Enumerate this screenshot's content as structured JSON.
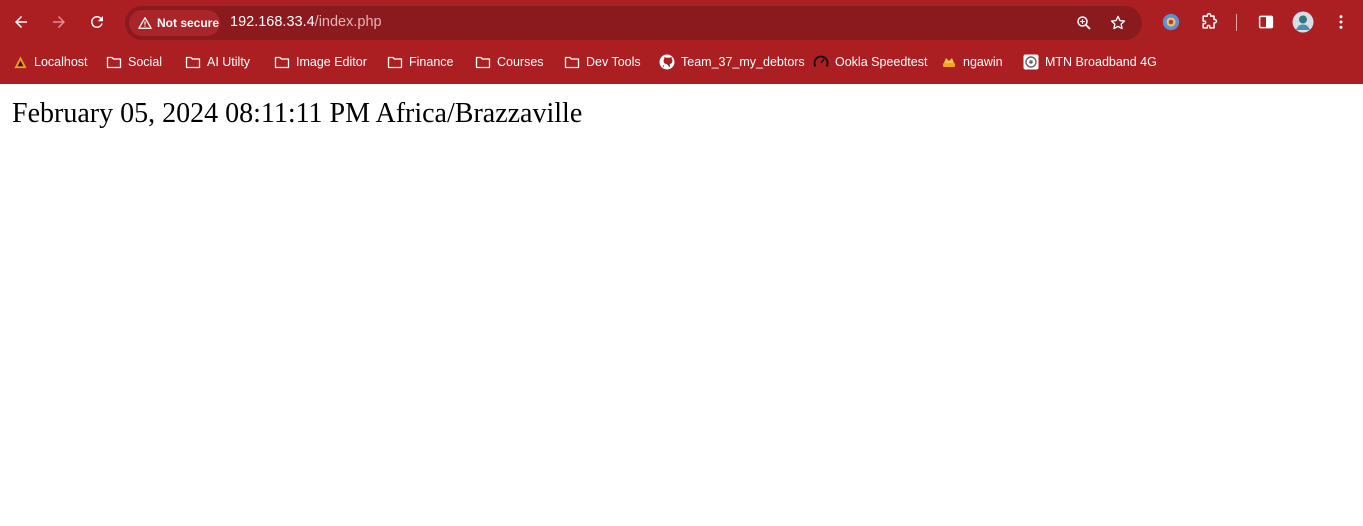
{
  "browser": {
    "nav": {
      "back_icon": "arrow-left-icon",
      "forward_icon": "arrow-right-icon",
      "reload_icon": "reload-icon"
    },
    "omnibox": {
      "security_label": "Not secure",
      "url_host": "192.168.33.4",
      "url_path": "/index.php",
      "zoom_icon": "zoom-icon",
      "bookmark_star_icon": "star-icon"
    },
    "toolbar_icons": [
      "extension-avatar-icon",
      "extensions-puzzle-icon",
      "side-panel-icon",
      "profile-avatar-icon",
      "kebab-menu-icon"
    ],
    "colors": {
      "chrome_bg": "#ab1f22",
      "omnibox_bg": "#8a1a1e",
      "chip_bg": "#a92529"
    }
  },
  "bookmarks": [
    {
      "label": "Localhost",
      "icon": "xampp-icon"
    },
    {
      "label": "Social",
      "icon": "folder-icon"
    },
    {
      "label": "AI Utilty",
      "icon": "folder-icon"
    },
    {
      "label": "Image Editor",
      "icon": "folder-icon"
    },
    {
      "label": "Finance",
      "icon": "folder-icon"
    },
    {
      "label": "Courses",
      "icon": "folder-icon"
    },
    {
      "label": "Dev Tools",
      "icon": "folder-icon"
    },
    {
      "label": "Team_37_my_debtors",
      "icon": "github-icon"
    },
    {
      "label": "Ookla Speedtest",
      "icon": "speedtest-icon"
    },
    {
      "label": "ngawin",
      "icon": "ngawin-icon"
    },
    {
      "label": "MTN Broadband 4G",
      "icon": "router-icon"
    }
  ],
  "page": {
    "datetime_text": "February 05, 2024 08:11:11 PM Africa/Brazzaville"
  }
}
